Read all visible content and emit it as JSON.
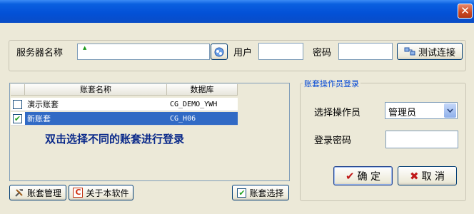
{
  "window": {
    "close_glyph": "✕"
  },
  "server": {
    "name_label": "服务器名称",
    "name_value": "",
    "user_label": "用户",
    "user_value": "",
    "password_label": "密码",
    "password_value": "",
    "test_button": "测试连接"
  },
  "accounts": {
    "columns": [
      "账套名称",
      "数据库"
    ],
    "rows": [
      {
        "checked": false,
        "name": "演示账套",
        "db": "CG_DEMO_YWH",
        "selected": false
      },
      {
        "checked": true,
        "name": "新账套",
        "db": "CG_H06",
        "selected": true
      }
    ],
    "hint": "双击选择不同的账套进行登录"
  },
  "bottom_buttons": {
    "manage": "账套管理",
    "about": "关于本软件",
    "select": "账套选择"
  },
  "login": {
    "group_title": "账套操作员登录",
    "operator_label": "选择操作员",
    "operator_value": "管理员",
    "password_label": "登录密码",
    "password_value": "",
    "ok_button": "确 定",
    "cancel_button": "取 消"
  },
  "colors": {
    "accent": "#316ac5",
    "title_blue": "#0350d6",
    "hint_blue": "#0b2a8a"
  }
}
